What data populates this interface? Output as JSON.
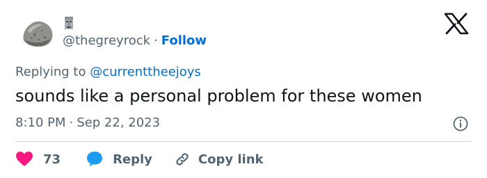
{
  "tweet": {
    "handle": "@thegreyrock",
    "separator": "·",
    "follow_label": "Follow",
    "replying_prefix": "Replying to",
    "replying_to": "@currenttheejoys",
    "text": "sounds like a personal problem for these women",
    "time": "8:10 PM",
    "date": "Sep 22, 2023"
  },
  "actions": {
    "like_count": "73",
    "reply_label": "Reply",
    "copy_label": "Copy link"
  },
  "icons": {
    "avatar": "grey-rock-image",
    "badge": "moai-emoji",
    "logo": "x-logo-icon",
    "info": "info-icon",
    "like": "heart-icon",
    "reply": "speech-bubble-icon",
    "copy": "link-icon"
  },
  "colors": {
    "link_blue": "#006fd6",
    "heart_red": "#f91880",
    "reply_blue": "#1d9bf0",
    "secondary_text": "#536471",
    "primary_text": "#0f1419",
    "divider": "#cfd9de"
  }
}
